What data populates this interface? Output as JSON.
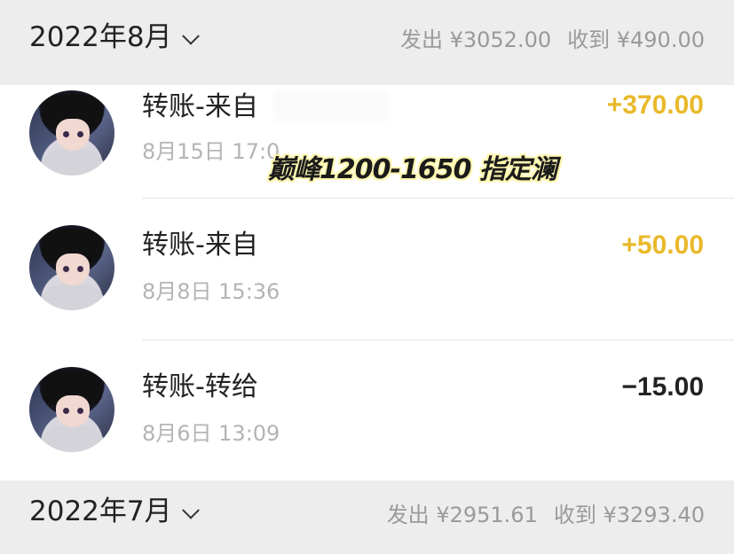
{
  "months": [
    {
      "title": "2022年8月",
      "expense": "发出 ¥3052.00",
      "income": "收到 ¥490.00"
    },
    {
      "title": "2022年7月",
      "expense": "发出 ¥2951.61",
      "income": "收到 ¥3293.40"
    }
  ],
  "transactions": [
    {
      "title": "转账-来自",
      "time": "8月15日 17:0",
      "amount": "+370.00",
      "type": "in"
    },
    {
      "title": "转账-来自",
      "time": "8月8日 15:36",
      "amount": "+50.00",
      "type": "in"
    },
    {
      "title": "转账-转给",
      "time": "8月6日 13:09",
      "amount": "−15.00",
      "type": "out"
    }
  ],
  "watermark": "巅峰1200-1650 指定澜",
  "icons": {
    "dropdown": "chevron-down-icon",
    "avatar": "avatar"
  },
  "colors": {
    "income": "#e9b92b",
    "expense": "#222222",
    "background": "#ededed"
  }
}
